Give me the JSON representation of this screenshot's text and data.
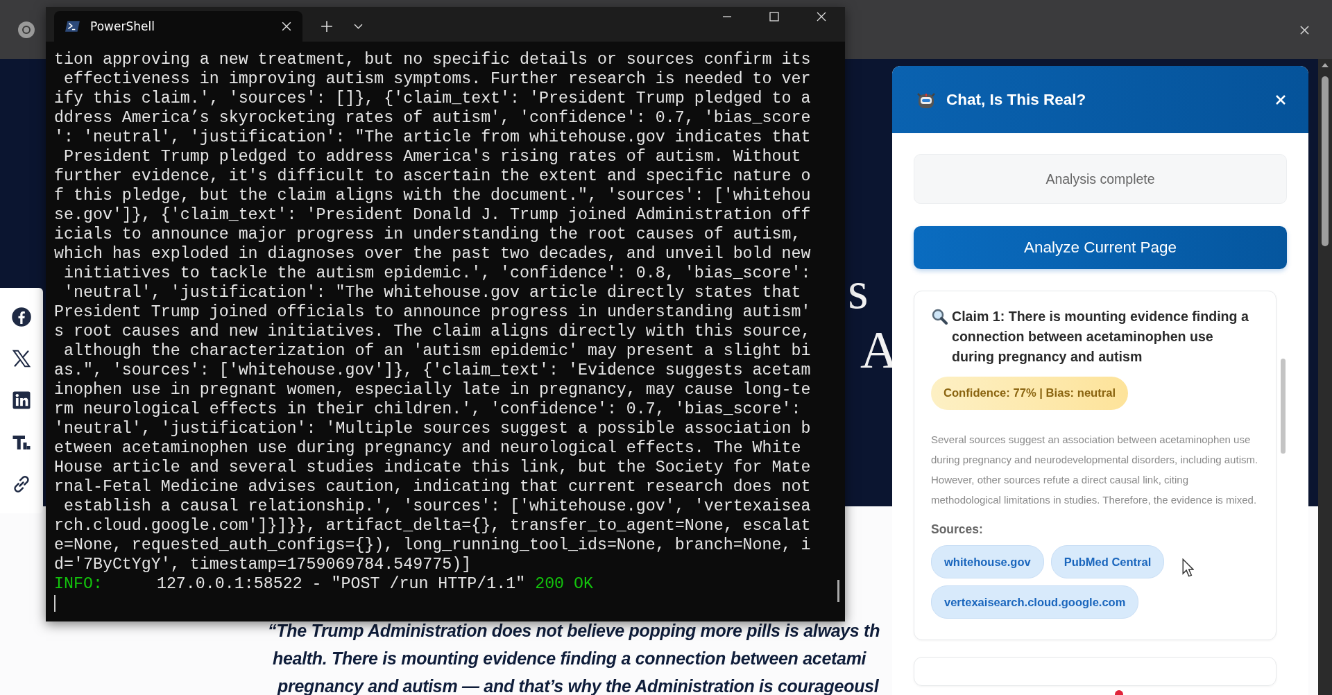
{
  "terminal": {
    "tab": {
      "title": "PowerShell",
      "selected": true
    },
    "lines": [
      "tion approving a new treatment, but no specific details or sources confirm its",
      " effectiveness in improving autism symptoms. Further research is needed to ver",
      "ify this claim.', 'sources': []}, {'claim_text': 'President Trump pledged to a",
      "ddress America’s skyrocketing rates of autism', 'confidence': 0.7, 'bias_score",
      "': 'neutral', 'justification': \"The article from whitehouse.gov indicates that",
      " President Trump pledged to address America's rising rates of autism. Without",
      "further evidence, it's difficult to ascertain the extent and specific nature o",
      "f this pledge, but the claim aligns with the document.\", 'sources': ['whitehou",
      "se.gov']}, {'claim_text': 'President Donald J. Trump joined Administration off",
      "icials to announce major progress in understanding the root causes of autism,",
      "which has exploded in diagnoses over the past two decades, and unveil bold new",
      " initiatives to tackle the autism epidemic.', 'confidence': 0.8, 'bias_score':",
      " 'neutral', 'justification': \"The whitehouse.gov article directly states that",
      "President Trump joined officials to announce progress in understanding autism'",
      "s root causes and new initiatives. The claim aligns directly with this source,",
      " although the characterization of an 'autism epidemic' may present a slight bi",
      "as.\", 'sources': ['whitehouse.gov']}, {'claim_text': 'Evidence suggests acetam",
      "inophen use in pregnant women, especially late in pregnancy, may cause long-te",
      "rm neurological effects in their children.', 'confidence': 0.7, 'bias_score':",
      "'neutral', 'justification': 'Multiple sources suggest a possible association b",
      "etween acetaminophen use during pregnancy and neurological effects. The White",
      "House article and several studies indicate this link, but the Society for Mate",
      "rnal-Fetal Medicine advises caution, indicating that current research does not",
      " establish a causal relationship.', 'sources': ['whitehouse.gov', 'vertexaisea",
      "rch.cloud.google.com']}]}}, artifact_delta={}, transfer_to_agent=None, escalat",
      "e=None, requested_auth_configs={}), long_running_tool_ids=None, branch=None, i",
      "d='7ByCtYgY', timestamp=1759069784.549775)]"
    ],
    "log": {
      "level": "INFO:",
      "message": "127.0.0.1:58522 - \"POST /run HTTP/1.1\"",
      "status": "200 OK"
    }
  },
  "page": {
    "hero_fragments": [
      "s",
      "A"
    ],
    "share_icons": [
      {
        "kind": "facebook"
      },
      {
        "kind": "x"
      },
      {
        "kind": "linkedin"
      },
      {
        "kind": "truth"
      },
      {
        "kind": "link"
      }
    ],
    "quote_lines": [
      "“The Trump Administration does not believe popping more pills is always th",
      "health. There is mounting evidence finding a connection between acetami",
      "pregnancy and autism — and that’s why the Administration is courageousl"
    ]
  },
  "extension": {
    "title": "Chat, Is This Real?",
    "status": "Analysis complete",
    "action": "Analyze Current Page",
    "claims": [
      {
        "title": "Claim 1: There is mounting evidence finding a connection between acetaminophen use during pregnancy and autism",
        "badge": "Confidence: 77% | Bias: neutral",
        "justification": "Several sources suggest an association between acetaminophen use during pregnancy and neurodevelopmental disorders, including autism. However, other sources refute a direct causal link, citing methodological limitations in studies. Therefore, the evidence is mixed.",
        "sources_label": "Sources:",
        "sources": [
          "whitehouse.gov",
          "PubMed Central",
          "vertexaisearch.cloud.google.com"
        ]
      }
    ]
  }
}
